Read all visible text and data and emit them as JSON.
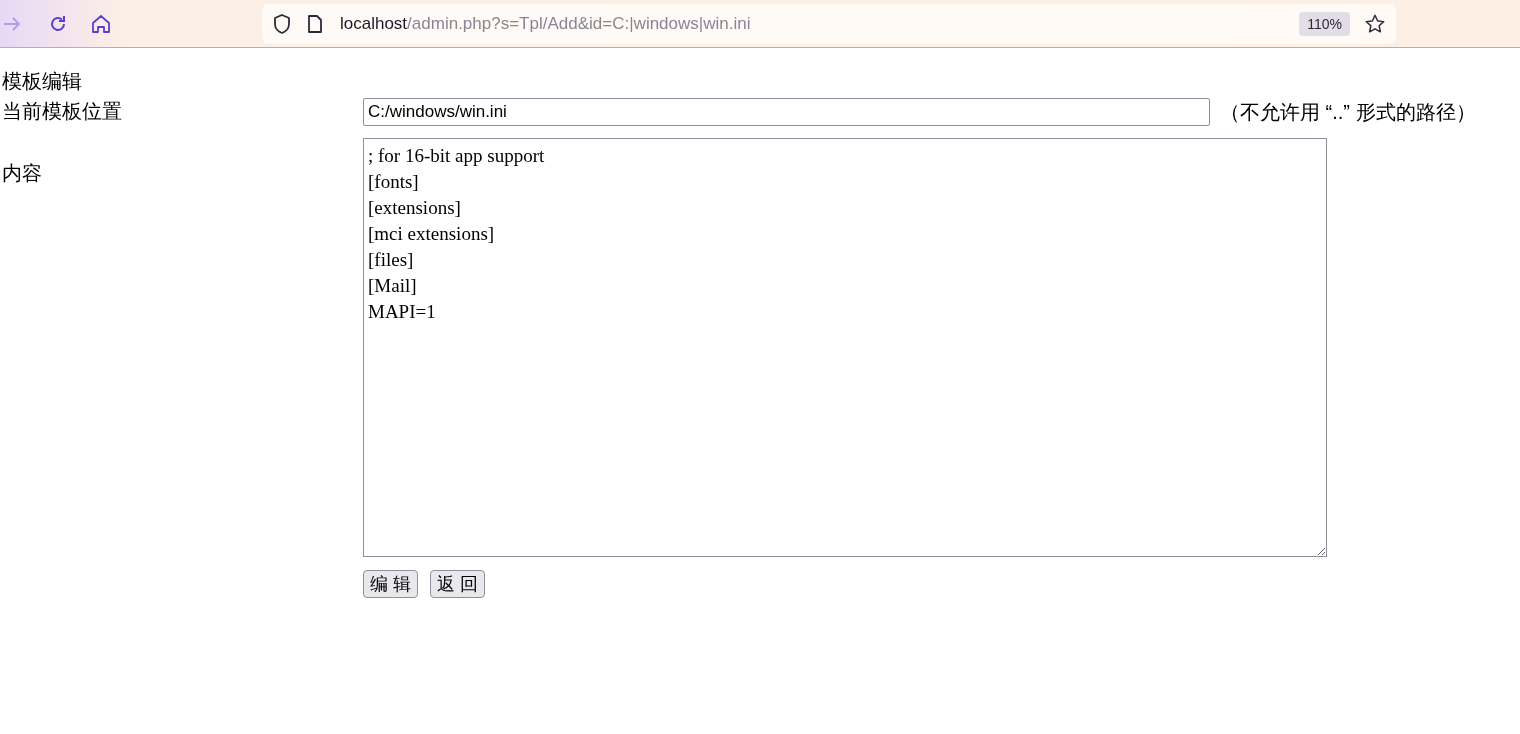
{
  "browser": {
    "url_host": "localhost",
    "url_path": "/admin.php?s=Tpl/Add&id=C:|windows|win.ini",
    "zoom": "110%"
  },
  "page": {
    "heading": "模板编辑",
    "location": {
      "label": "当前模板位置",
      "value": "C:/windows/win.ini",
      "note": "（不允许用 “..” 形式的路径）"
    },
    "content": {
      "label": "内容",
      "lines": [
        "; for 16-bit app support",
        "[fonts]",
        "[extensions]",
        "[mci extensions]",
        "[files]",
        "[Mail]",
        "MAPI=1"
      ]
    },
    "buttons": [
      "编 辑",
      "返 回"
    ]
  }
}
